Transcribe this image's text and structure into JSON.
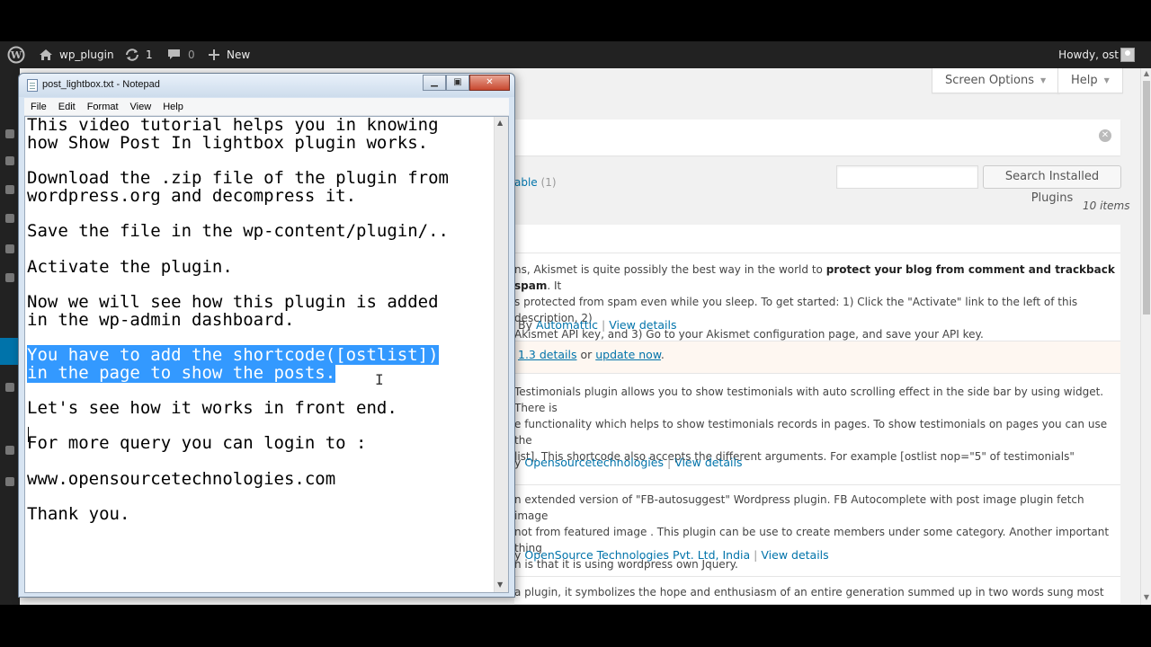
{
  "adminbar": {
    "site_name": "wp_plugin",
    "updates_count": "1",
    "comments_count": "0",
    "new_label": "New",
    "howdy": "Howdy, ost"
  },
  "screen_options_label": "Screen Options",
  "help_label": "Help",
  "filter": {
    "label": "able",
    "count": "(1)"
  },
  "search_button_label": "Search Installed Plugins",
  "items_count": "10 items",
  "plugins": [
    {
      "description_lines": [
        "ns, Akismet is quite possibly the best way in the world to ",
        "s protected from spam even while you sleep. To get started: 1) Click the \"Activate\" link to the left of this description, 2)",
        " Akismet API key, and 3) Go to your Akismet configuration page, and save your API key."
      ],
      "description_bold": "protect your blog from comment and trackback spam",
      "description_tail": ". It",
      "by_prefix": "By ",
      "author": "Automattic",
      "view_details": "View details"
    },
    {
      "description_lines": [
        "Testimonials plugin allows you to show testimonials with auto scrolling effect in the side bar by using widget. There is",
        "e functionality which helps to show testimonials records in pages. To show testimonials on pages you can use the",
        "list]. This shortcode also accepts the different arguments. For example [ostlist nop=\"5\" of testimonials\""
      ],
      "by_prefix": "y ",
      "author": "Opensourcetechnologies",
      "view_details": "View details"
    },
    {
      "description_lines": [
        "n extended version of \"FB-autosuggest\" Wordpress plugin. FB Autocomplete with post image plugin fetch image",
        "not from featured image . This plugin can be use to create members under some category. Another important thing",
        "n is that it is using wordpress own Jquery."
      ],
      "by_prefix": "y ",
      "author": "OpenSource Technologies Pvt. Ltd, India",
      "view_details": "View details"
    },
    {
      "description_lines": [
        "a plugin, it symbolizes the hope and enthusiasm of an entire generation summed up in two words sung most"
      ]
    }
  ],
  "update_notice": {
    "version_link": "1.3 details",
    "or": " or ",
    "update_link": "update now",
    "end": "."
  },
  "notepad": {
    "title": "post_lightbox.txt - Notepad",
    "menu": [
      "File",
      "Edit",
      "Format",
      "View",
      "Help"
    ],
    "lines_before": [
      "This video tutorial helps you in knowing",
      "how Show Post In lightbox plugin works.",
      "",
      "Download the .zip file of the plugin from",
      "wordpress.org and decompress it.",
      "",
      "Save the file in the wp-content/plugin/..",
      "",
      "Activate the plugin.",
      "",
      "Now we will see how this plugin is added",
      "in the wp-admin dashboard.",
      ""
    ],
    "selected_lines": [
      "You have to add the shortcode([ostlist])",
      "in the page to show the posts."
    ],
    "lines_after": [
      "",
      "Let's see how it works in front end.",
      "",
      "For more query you can login to :",
      "",
      "www.opensourcetechnologies.com",
      "",
      "Thank you."
    ]
  },
  "colors": {
    "adminbar": "#222222",
    "link": "#0073aa",
    "selection": "#3399ff"
  },
  "icons": [
    "wordpress-logo-icon",
    "home-icon",
    "updates-icon",
    "comment-icon",
    "plus-icon",
    "avatar"
  ]
}
